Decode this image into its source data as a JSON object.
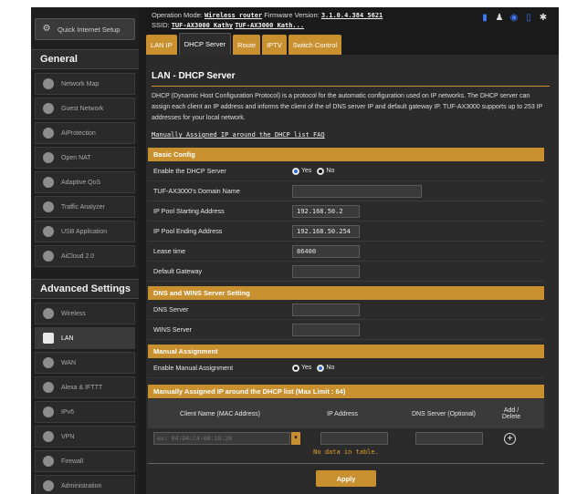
{
  "header": {
    "operation_mode_label": "Operation Mode:",
    "operation_mode_value": "Wireless router",
    "firmware_label": "Firmware Version:",
    "firmware_value": "3.1.0.4.384_5621",
    "ssid_label": "SSID:",
    "ssid_1": "TUF-AX3000_Kathy",
    "ssid_2": "TUF-AX3000_Kath..."
  },
  "sidebar": {
    "quick_setup": "Quick Internet Setup",
    "general_header": "General",
    "general_items": [
      {
        "label": "Network Map",
        "icon": "network-map-icon"
      },
      {
        "label": "Guest Network",
        "icon": "guest-network-icon"
      },
      {
        "label": "AiProtection",
        "icon": "aiprotection-icon"
      },
      {
        "label": "Open NAT",
        "icon": "open-nat-icon"
      },
      {
        "label": "Adaptive QoS",
        "icon": "qos-icon"
      },
      {
        "label": "Traffic Analyzer",
        "icon": "traffic-analyzer-icon"
      },
      {
        "label": "USB Application",
        "icon": "usb-icon"
      },
      {
        "label": "AiCloud 2.0",
        "icon": "cloud-icon"
      }
    ],
    "advanced_header": "Advanced Settings",
    "advanced_items": [
      {
        "label": "Wireless",
        "icon": "wireless-icon"
      },
      {
        "label": "LAN",
        "icon": "lan-icon",
        "active": true
      },
      {
        "label": "WAN",
        "icon": "wan-icon"
      },
      {
        "label": "Alexa & IFTTT",
        "icon": "alexa-icon"
      },
      {
        "label": "IPv6",
        "icon": "ipv6-icon"
      },
      {
        "label": "VPN",
        "icon": "vpn-icon"
      },
      {
        "label": "Firewall",
        "icon": "firewall-icon"
      },
      {
        "label": "Administration",
        "icon": "administration-icon"
      }
    ]
  },
  "tabs": [
    "LAN IP",
    "DHCP Server",
    "Route",
    "IPTV",
    "Switch Control"
  ],
  "active_tab": "DHCP Server",
  "page": {
    "title": "LAN - DHCP Server",
    "description": "DHCP (Dynamic Host Configuration Protocol) is a protocol for the automatic configuration used on IP networks. The DHCP server can assign each client an IP address and informs the client of the of DNS server IP and default gateway IP. TUF-AX3000 supports up to 253 IP addresses for your local network.",
    "faq_link": "Manually Assigned IP around the DHCP list FAQ"
  },
  "basic_config": {
    "header": "Basic Config",
    "enable_label": "Enable the DHCP Server",
    "enable_yes": "Yes",
    "enable_no": "No",
    "enable_value": "Yes",
    "domain_label": "TUF-AX3000's Domain Name",
    "domain_value": "",
    "start_label": "IP Pool Starting Address",
    "start_value": "192.168.50.2",
    "end_label": "IP Pool Ending Address",
    "end_value": "192.168.50.254",
    "lease_label": "Lease time",
    "lease_value": "86400",
    "gateway_label": "Default Gateway",
    "gateway_value": ""
  },
  "dns_wins": {
    "header": "DNS and WINS Server Setting",
    "dns_label": "DNS Server",
    "dns_value": "",
    "wins_label": "WINS Server",
    "wins_value": ""
  },
  "manual": {
    "header": "Manual Assignment",
    "enable_label": "Enable Manual Assignment",
    "yes": "Yes",
    "no": "No",
    "value": "No"
  },
  "manual_list": {
    "header": "Manually Assigned IP around the DHCP list (Max Limit : 64)",
    "col_client": "Client Name (MAC Address)",
    "col_ip": "IP Address",
    "col_dns": "DNS Server (Optional)",
    "col_add": "Add / Delete",
    "mac_placeholder": "ex: 04:D4:C4:6B:18:20",
    "empty_text": "No data in table."
  },
  "apply_label": "Apply",
  "colors": {
    "accent": "#c8902e",
    "background": "#2b2b2b",
    "sidebar": "#1f1f1f"
  }
}
